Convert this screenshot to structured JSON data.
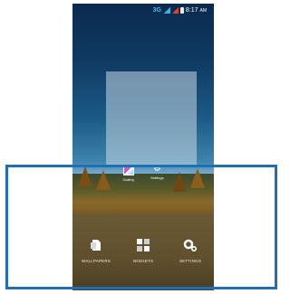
{
  "status_bar": {
    "network": "3G",
    "time": "8:17",
    "meridiem": "AM"
  },
  "mini_icons": [
    {
      "label": "Gallery",
      "icon": "gallery-icon"
    },
    {
      "label": "Settings",
      "icon": "gear-icon"
    }
  ],
  "options": [
    {
      "label": "WALLPAPERS",
      "icon": "wallpaper-icon"
    },
    {
      "label": "WIDGETS",
      "icon": "widgets-icon"
    },
    {
      "label": "SETTINGS",
      "icon": "settings-icon"
    }
  ],
  "colors": {
    "highlight_border": "#1f6fb4",
    "status_accent": "#34c4f0"
  }
}
